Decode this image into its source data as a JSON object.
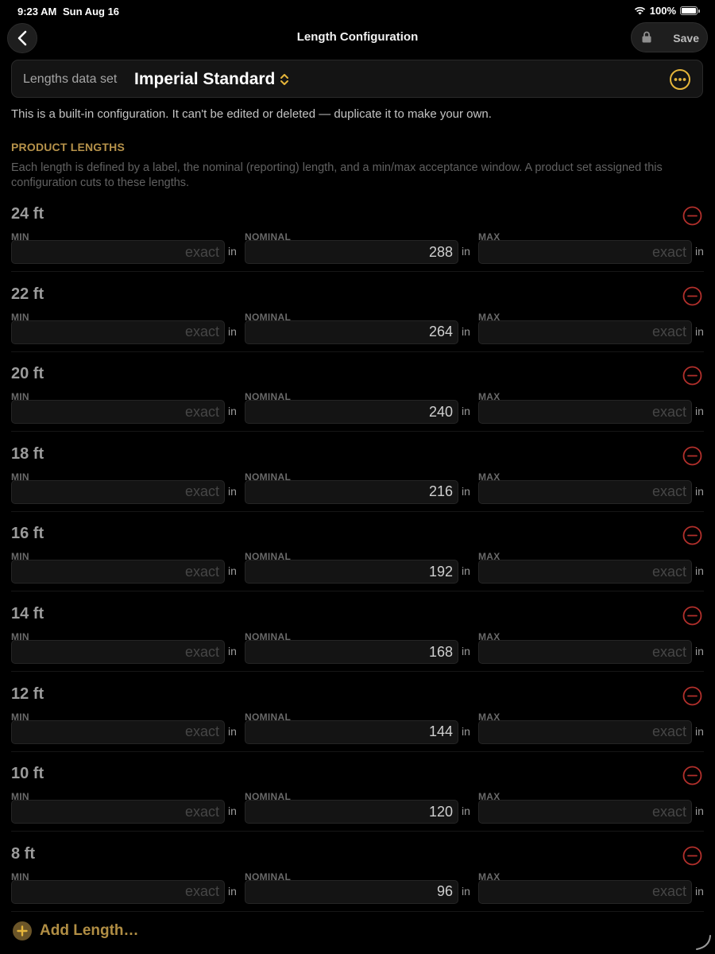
{
  "status_bar": {
    "time": "9:23 AM",
    "date": "Sun Aug 16",
    "battery": "100%"
  },
  "nav": {
    "title": "Length Configuration",
    "save_label": "Save"
  },
  "dataset": {
    "label": "Lengths data set",
    "value": "Imperial Standard"
  },
  "builtin_note": "This is a built-in configuration. It can't be edited or deleted — duplicate it to make your own.",
  "section": {
    "header": "PRODUCT LENGTHS",
    "description": "Each length is defined by a label, the nominal (reporting) length, and a min/max acceptance window. A product set assigned this configuration cuts to these lengths."
  },
  "field_labels": {
    "min": "MIN",
    "nominal": "NOMINAL",
    "max": "MAX"
  },
  "placeholder": "exact",
  "unit": "in",
  "lengths": [
    {
      "label": "24 ft",
      "min": "",
      "nominal": "288",
      "max": ""
    },
    {
      "label": "22 ft",
      "min": "",
      "nominal": "264",
      "max": ""
    },
    {
      "label": "20 ft",
      "min": "",
      "nominal": "240",
      "max": ""
    },
    {
      "label": "18 ft",
      "min": "",
      "nominal": "216",
      "max": ""
    },
    {
      "label": "16 ft",
      "min": "",
      "nominal": "192",
      "max": ""
    },
    {
      "label": "14 ft",
      "min": "",
      "nominal": "168",
      "max": ""
    },
    {
      "label": "12 ft",
      "min": "",
      "nominal": "144",
      "max": ""
    },
    {
      "label": "10 ft",
      "min": "",
      "nominal": "120",
      "max": ""
    },
    {
      "label": "8 ft",
      "min": "",
      "nominal": "96",
      "max": ""
    }
  ],
  "add_length_label": "Add Length…",
  "colors": {
    "accent": "#b6924a",
    "accent_ring": "#e5b53a",
    "remove": "#b3302c",
    "background": "#000000"
  },
  "icons": {
    "back": "chevron-left-icon",
    "lock": "lock-icon",
    "selector": "chevron-up-down-icon",
    "more": "ellipsis-circle-icon",
    "remove": "minus-circle-icon",
    "add": "plus-circle-icon"
  }
}
